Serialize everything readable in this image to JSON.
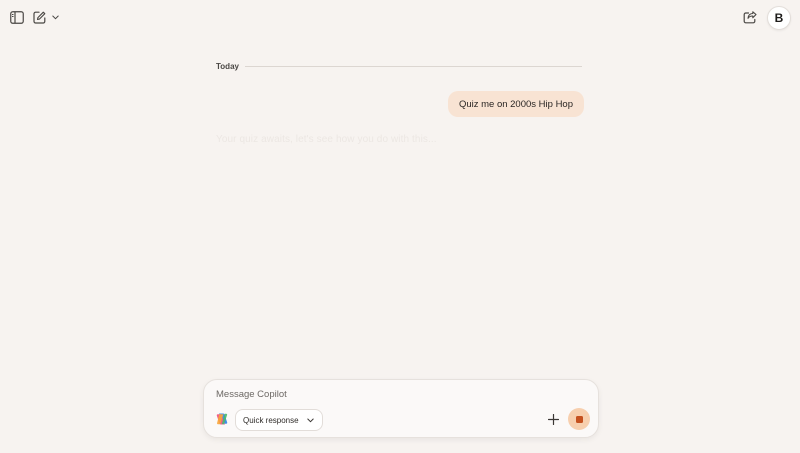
{
  "topbar": {
    "avatar_initial": "B"
  },
  "conversation": {
    "date_label": "Today",
    "user_message": "Quiz me on 2000s Hip Hop",
    "assistant_partial": "Your quiz awaits, let's see how you do with this..."
  },
  "composer": {
    "placeholder": "Message Copilot",
    "value": "",
    "mode_label": "Quick response"
  },
  "colors": {
    "background": "#f7f3f0",
    "user_bubble": "#f8e3d3",
    "stop_button": "#f7cfae",
    "stop_icon": "#c5511f"
  },
  "icons": {
    "sidebar_toggle": "sidebar-icon",
    "new_chat": "compose-icon",
    "share": "share-icon",
    "mode_chevron": "chevron-down-icon",
    "add": "plus-icon",
    "stop": "stop-icon",
    "logo": "copilot-logo-icon"
  }
}
